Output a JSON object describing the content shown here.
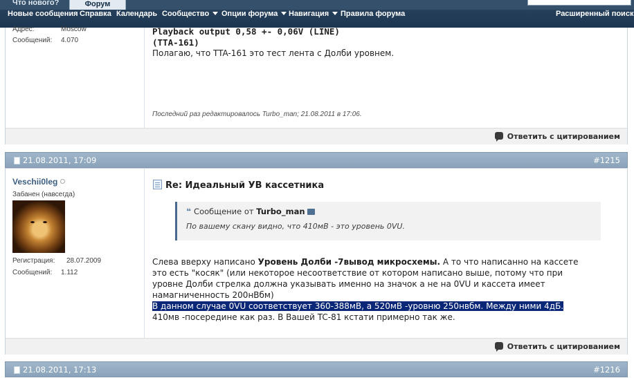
{
  "topbar": {
    "tab_whatsnew": "Что нового?",
    "tab_forum": "Форум"
  },
  "navbar": {
    "new_posts": "Новые сообщения",
    "help": "Справка",
    "calendar": "Календарь",
    "community": "Сообщество",
    "forum_options": "Опции форума",
    "navigation": "Навигация",
    "rules": "Правила форума",
    "advanced_search": "Расширенный поиск"
  },
  "post1": {
    "address_label": "Адрес:",
    "address_value": "Moscow",
    "posts_label": "Сообщений:",
    "posts_value": "4.070",
    "line1": "Playback output 0,58 +- 0,06V (LINE)",
    "line2": "(TTA-161)",
    "body": "Полагаю, что TTA-161 это тест лента с Долби уровнем.",
    "edited": "Последний раз редактировалось Turbo_man; 21.08.2011 в 17:06.",
    "reply": "Ответить с цитированием"
  },
  "post2": {
    "date": "21.08.2011, 17:09",
    "number": "#1215",
    "username": "Veschii0leg",
    "user_title": "Забанен (навсегда)",
    "reg_label": "Регистрация:",
    "reg_value": "28.07.2009",
    "posts_label": "Сообщений:",
    "posts_value": "1.112",
    "title": "Re: Идеальный УВ кассетника",
    "quote_prefix": "Сообщение от",
    "quote_author": "Turbo_man",
    "quote_text": "По вашему скану видно, что 410мВ - это уровень 0VU.",
    "p1_a": "Слева вверху написано ",
    "p1_bold": "Уровень Долби -7вывод микросхемы.",
    "p1_b": " А то что написанно на кассете",
    "p1_line2": "это есть \"косяк\" (или некоторое несоответствие от котором написано выше, потому что при",
    "p1_line3": "уровне Долби стрелка должна указывать именно на значок а не на 0VU и кассета имеет",
    "p1_line4": "намагниченность 200нВбм)",
    "highlight": "В данном случае 0VU соответствует 360-388мВ, а 520мВ -уровню 250нвбм. Между ними 4дБ.",
    "p2": "410мв -посередине как раз. В Вашей TC-81 кстати примерно так же.",
    "reply": "Ответить с цитированием"
  },
  "post3": {
    "date": "21.08.2011, 17:13",
    "number": "#1216"
  }
}
